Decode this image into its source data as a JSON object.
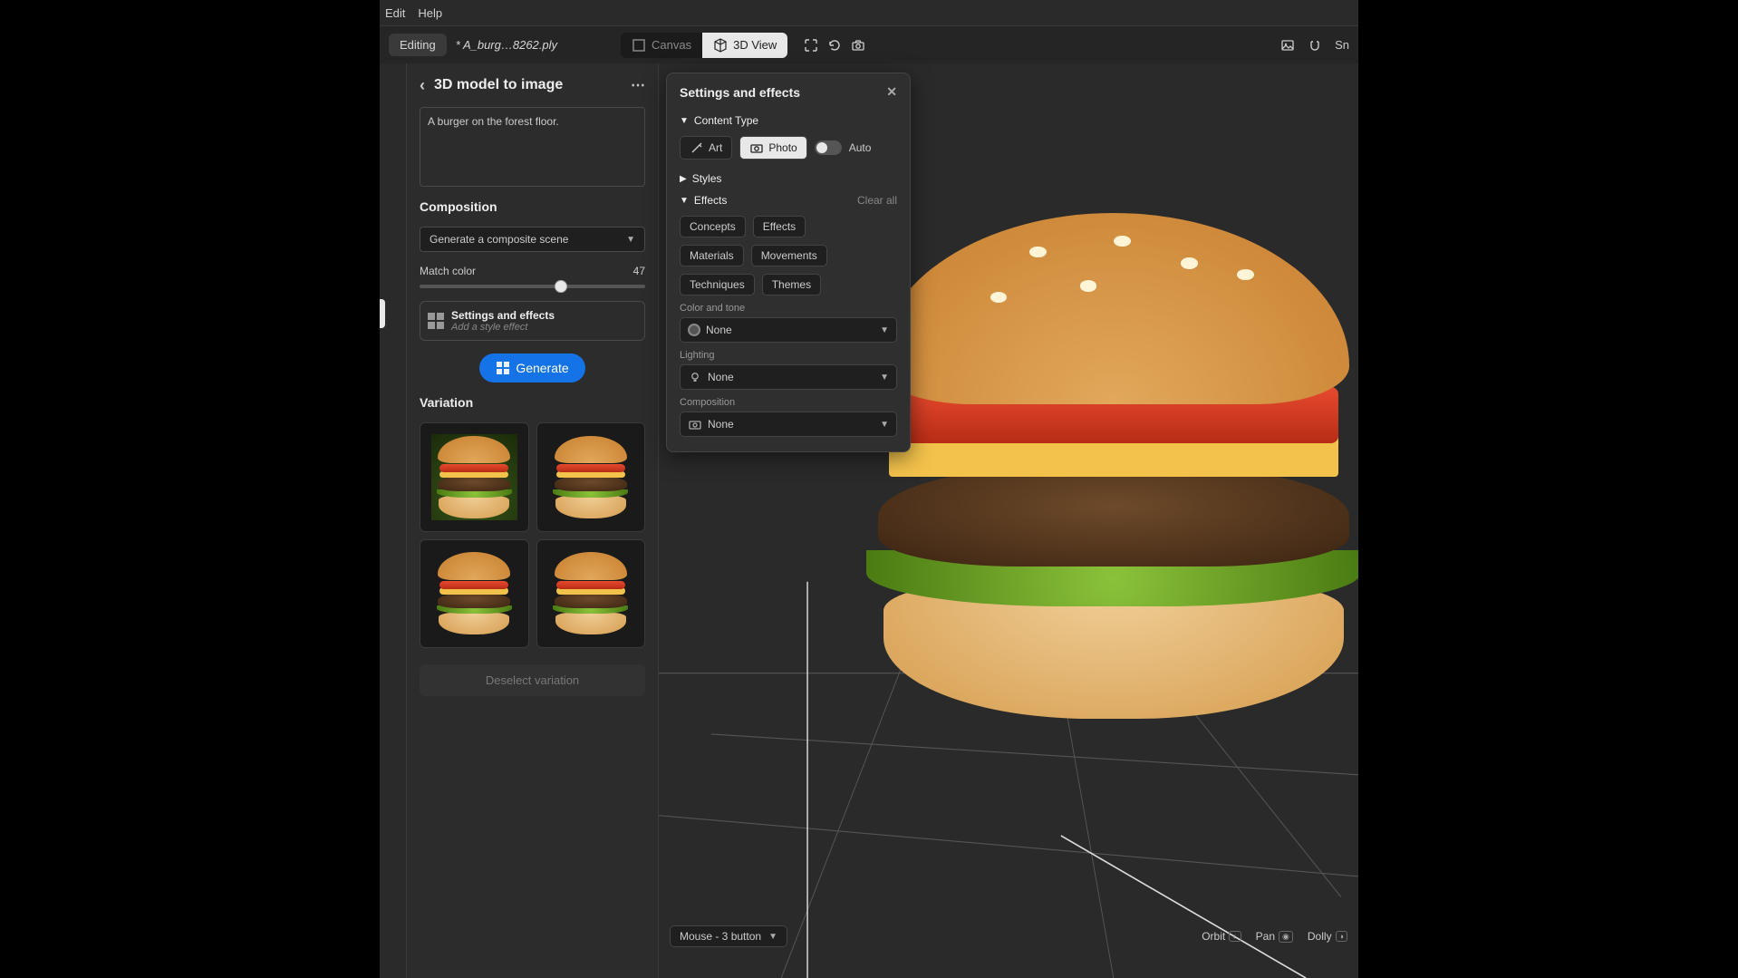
{
  "menubar": {
    "edit": "Edit",
    "help": "Help"
  },
  "toolbar": {
    "editing": "Editing",
    "filename": "* A_burg…8262.ply",
    "canvas": "Canvas",
    "view3d": "3D View",
    "snap": "Sn"
  },
  "panel": {
    "title": "3D model to image",
    "prompt": "A burger on the forest floor.",
    "composition_title": "Composition",
    "composition_value": "Generate a composite scene",
    "match_color_label": "Match color",
    "match_color_value": "47",
    "settings_effects_title": "Settings and effects",
    "settings_effects_hint": "Add a style effect",
    "generate": "Generate",
    "variation_title": "Variation",
    "deselect": "Deselect variation"
  },
  "float": {
    "title": "Settings and effects",
    "content_type": "Content Type",
    "art": "Art",
    "photo": "Photo",
    "auto": "Auto",
    "styles": "Styles",
    "effects": "Effects",
    "clear_all": "Clear all",
    "tags": {
      "concepts": "Concepts",
      "effects": "Effects",
      "materials": "Materials",
      "movements": "Movements",
      "techniques": "Techniques",
      "themes": "Themes"
    },
    "color_tone_label": "Color and tone",
    "lighting_label": "Lighting",
    "composition_label": "Composition",
    "none": "None"
  },
  "status": {
    "mouse": "Mouse - 3 button",
    "orbit": "Orbit",
    "pan": "Pan",
    "dolly": "Dolly"
  }
}
